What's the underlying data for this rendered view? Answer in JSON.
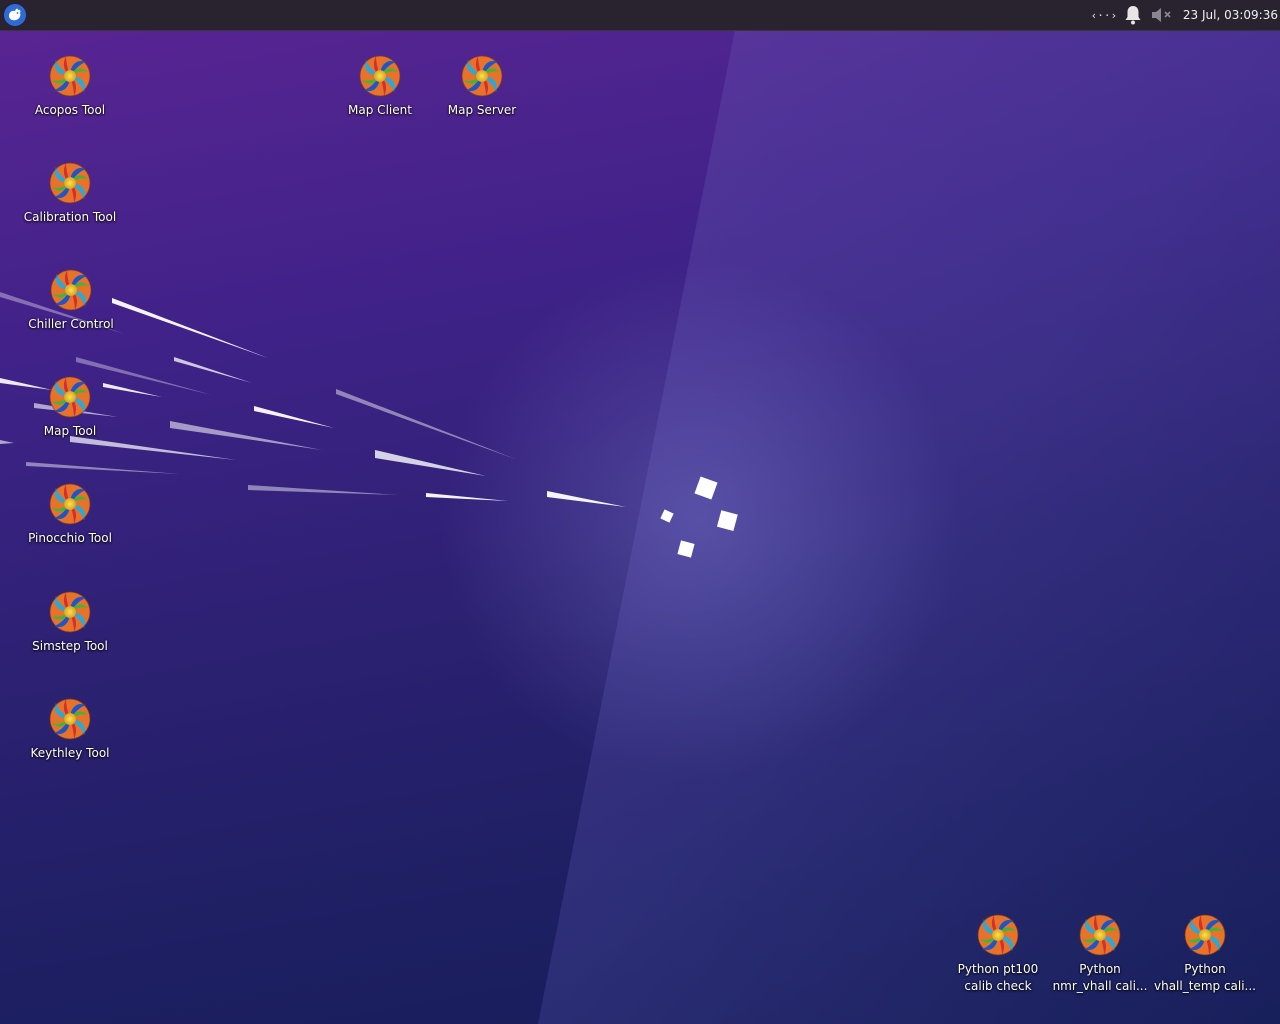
{
  "panel": {
    "network_indicator": "‹··›",
    "clock": "23 Jul, 03:09:36",
    "menu_icon": "xfce-mouse-icon",
    "notification_icon": "bell-icon",
    "volume_icon": "volume-muted-icon"
  },
  "desktop": {
    "icons_left": [
      {
        "label": "Acopos Tool"
      },
      {
        "label": "Calibration Tool"
      },
      {
        "label": "Chiller Control"
      },
      {
        "label": "Map Tool"
      },
      {
        "label": "Pinocchio Tool"
      },
      {
        "label": "Simstep Tool"
      },
      {
        "label": "Keythley Tool"
      }
    ],
    "icons_top": [
      {
        "label": "Map Client"
      },
      {
        "label": "Map Server"
      }
    ],
    "icons_bottom": [
      {
        "label_line1": "Python pt100",
        "label_line2": "calib check"
      },
      {
        "label_line1": "Python",
        "label_line2": "nmr_vhall cali..."
      },
      {
        "label_line1": "Python",
        "label_line2": "vhall_temp cali..."
      }
    ]
  },
  "colors": {
    "panel_bg": "#28232f",
    "wallpaper_top": "#5b2594",
    "wallpaper_bottom": "#161d57"
  }
}
